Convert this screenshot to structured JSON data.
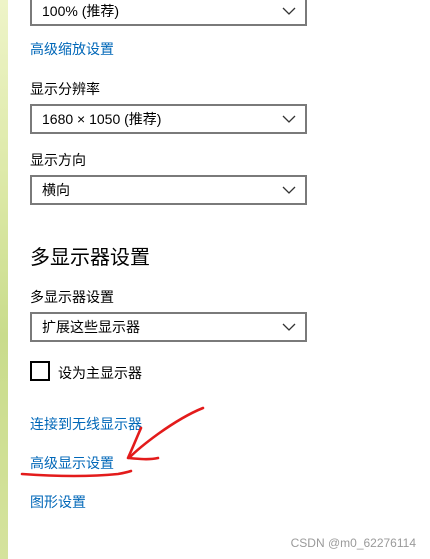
{
  "scale_dropdown": {
    "value": "100% (推荐)"
  },
  "advanced_scaling_link": "高级缩放设置",
  "resolution": {
    "label": "显示分辨率",
    "value": "1680 × 1050 (推荐)"
  },
  "orientation": {
    "label": "显示方向",
    "value": "横向"
  },
  "multi_display": {
    "title": "多显示器设置",
    "label": "多显示器设置",
    "value": "扩展这些显示器",
    "primary_checkbox_label": "设为主显示器",
    "primary_checked": false
  },
  "links": {
    "wireless": "连接到无线显示器",
    "advanced_display": "高级显示设置",
    "graphics": "图形设置"
  },
  "watermark": "CSDN @m0_62276114",
  "colors": {
    "link": "#0067b8",
    "annotation": "#e31b1b"
  },
  "icons": {
    "dropdown": "chevron-down-icon",
    "annotation": "red-arrow-underline"
  }
}
